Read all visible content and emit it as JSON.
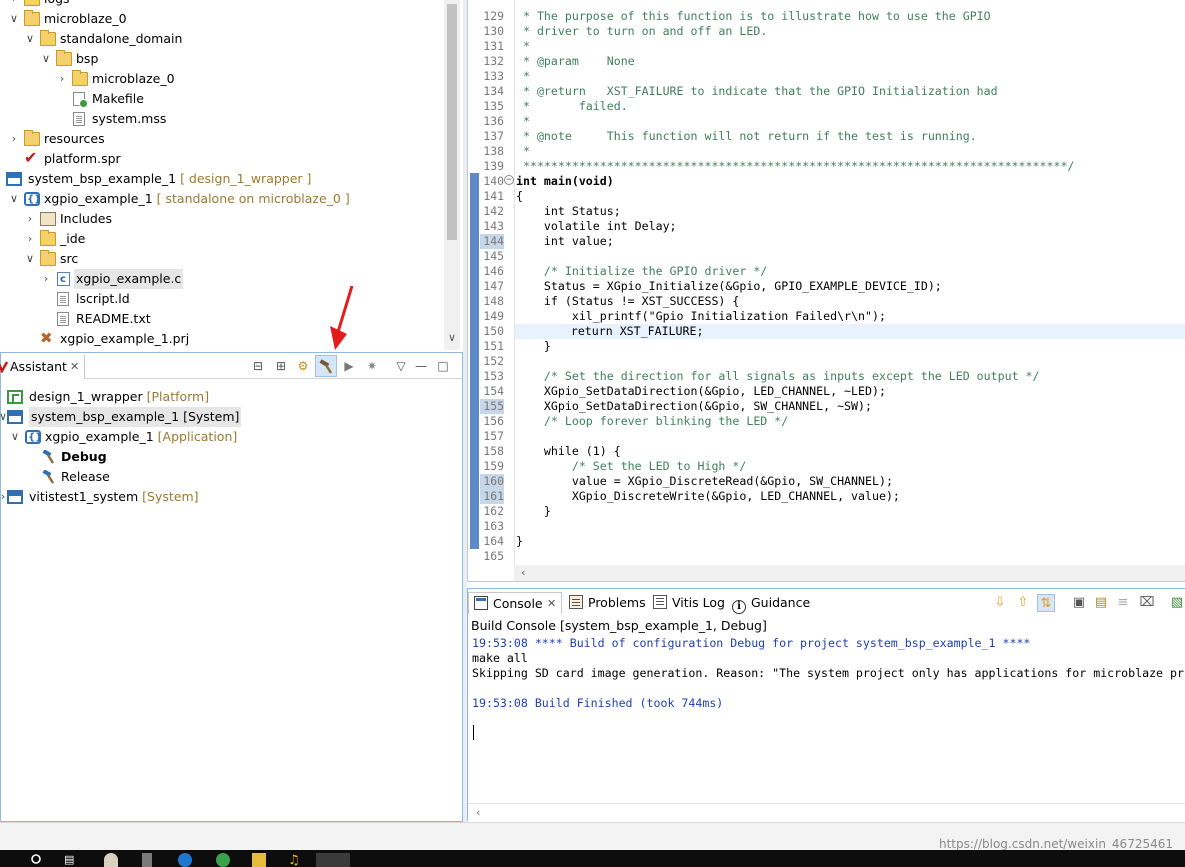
{
  "explorer": {
    "items": [
      {
        "label": "logs",
        "decoration": ""
      },
      {
        "label": "microblaze_0",
        "decoration": ""
      },
      {
        "label": "standalone_domain",
        "decoration": ""
      },
      {
        "label": "bsp",
        "decoration": ""
      },
      {
        "label": "microblaze_0",
        "decoration": ""
      },
      {
        "label": "Makefile",
        "decoration": ""
      },
      {
        "label": "system.mss",
        "decoration": ""
      },
      {
        "label": "resources",
        "decoration": ""
      },
      {
        "label": "platform.spr",
        "decoration": ""
      },
      {
        "label": "system_bsp_example_1",
        "decoration": "[ design_1_wrapper ]"
      },
      {
        "label": "xgpio_example_1",
        "decoration": "[ standalone on microblaze_0 ]"
      },
      {
        "label": "Includes",
        "decoration": ""
      },
      {
        "label": "_ide",
        "decoration": ""
      },
      {
        "label": "src",
        "decoration": ""
      },
      {
        "label": "xgpio_example.c",
        "decoration": ""
      },
      {
        "label": "lscript.ld",
        "decoration": ""
      },
      {
        "label": "README.txt",
        "decoration": ""
      },
      {
        "label": "xgpio_example_1.prj",
        "decoration": ""
      }
    ]
  },
  "assistant": {
    "tab_label": "Assistant",
    "tab_close": "✕",
    "items": [
      {
        "label": "design_1_wrapper",
        "decoration": "[Platform]"
      },
      {
        "label": "system_bsp_example_1",
        "decoration": "[System]"
      },
      {
        "label": "xgpio_example_1",
        "decoration": "[Application]"
      },
      {
        "label": "Debug",
        "decoration": ""
      },
      {
        "label": "Release",
        "decoration": ""
      },
      {
        "label": "vitistest1_system",
        "decoration": "[System]"
      }
    ]
  },
  "editor": {
    "line_numbers": [
      "129",
      "130",
      "131",
      "132",
      "133",
      "134",
      "135",
      "136",
      "137",
      "138",
      "139",
      "140",
      "141",
      "142",
      "143",
      "144",
      "145",
      "146",
      "147",
      "148",
      "149",
      "150",
      "151",
      "152",
      "153",
      "154",
      "155",
      "156",
      "157",
      "158",
      "159",
      "160",
      "161",
      "162",
      "163",
      "164",
      "165"
    ],
    "lines": [
      " * The purpose of this function is to illustrate how to use the GPIO",
      " * driver to turn on and off an LED.",
      " *",
      " * @param    None",
      " *",
      " * @return   XST_FAILURE to indicate that the GPIO Initialization had",
      " *       failed.",
      " *",
      " * @note     This function will not return if the test is running.",
      " *",
      " ******************************************************************************/",
      "int main(void)",
      "{",
      "    int Status;",
      "    volatile int Delay;",
      "    int value;",
      "",
      "    /* Initialize the GPIO driver */",
      "    Status = XGpio_Initialize(&Gpio, GPIO_EXAMPLE_DEVICE_ID);",
      "    if (Status != XST_SUCCESS) {",
      "        xil_printf(\"Gpio Initialization Failed\\r\\n\");",
      "        return XST_FAILURE;",
      "    }",
      "",
      "    /* Set the direction for all signals as inputs except the LED output */",
      "    XGpio_SetDataDirection(&Gpio, LED_CHANNEL, ~LED);",
      "    XGpio_SetDataDirection(&Gpio, SW_CHANNEL, ~SW);",
      "    /* Loop forever blinking the LED */",
      "",
      "    while (1) {",
      "        /* Set the LED to High */",
      "        value = XGpio_DiscreteRead(&Gpio, SW_CHANNEL);",
      "        XGpio_DiscreteWrite(&Gpio, LED_CHANNEL, value);",
      "    }",
      "",
      "}",
      ""
    ]
  },
  "console": {
    "tabs": [
      {
        "label": "Console",
        "close": "✕"
      },
      {
        "label": "Problems"
      },
      {
        "label": "Vitis Log"
      },
      {
        "label": "Guidance"
      }
    ],
    "title": "Build Console [system_bsp_example_1, Debug]",
    "lines": [
      {
        "text": "19:53:08 **** Build of configuration Debug for project system_bsp_example_1 ****",
        "style": "blue"
      },
      {
        "text": "make all",
        "style": "black"
      },
      {
        "text": "Skipping SD card image generation. Reason: \"The system project only has applications for microblaze pr",
        "style": "black"
      },
      {
        "text": "",
        "style": "black"
      },
      {
        "text": "19:53:08 Build Finished (took 744ms)",
        "style": "blue"
      }
    ]
  },
  "watermark": "https://blog.csdn.net/weixin_46725461",
  "colors": {
    "accent_blue": "#8fb8dc",
    "keyword": "#7f0055",
    "comment": "#3f7f5f",
    "string": "#2a00ff",
    "decoration": "#9b7a30",
    "annotation_arrow": "#e21b1b"
  }
}
